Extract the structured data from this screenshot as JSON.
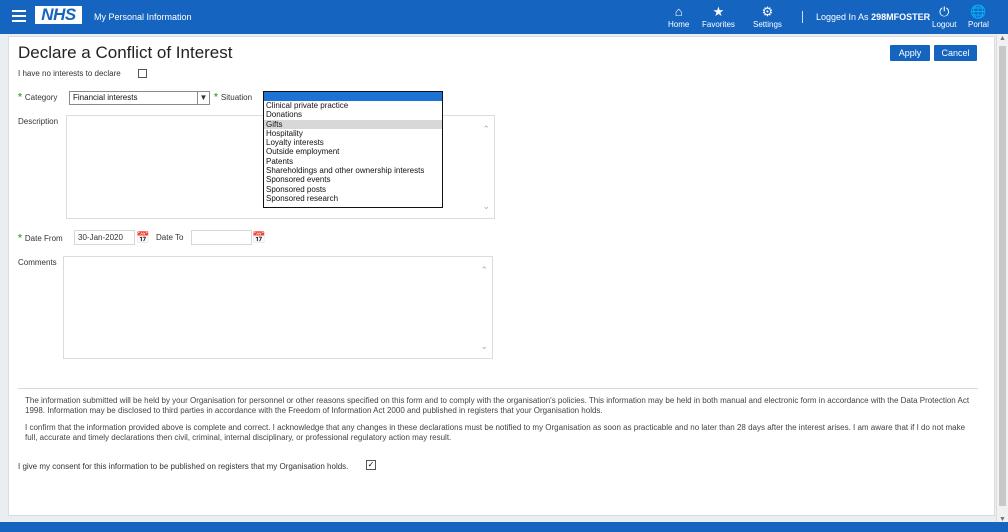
{
  "header": {
    "app_title": "My Personal Information",
    "logo_text": "NHS",
    "nav": [
      {
        "label": "Home",
        "icon": "home-icon"
      },
      {
        "label": "Favorites",
        "icon": "star-icon"
      },
      {
        "label": "Settings",
        "icon": "gear-icon"
      }
    ],
    "login_prefix": "Logged In As",
    "username": "298MFOSTER",
    "logout_label": "Logout",
    "portal_label": "Portal"
  },
  "form": {
    "title": "Declare a Conflict of Interest",
    "apply_label": "Apply",
    "cancel_label": "Cancel",
    "no_interests_label": "I have no interests to declare",
    "category_label": "Category",
    "category_value": "Financial interests",
    "situation_label": "Situation",
    "situation_options": [
      "Clinical private practice",
      "Donations",
      "Gifts",
      "Hospitality",
      "Loyalty interests",
      "Outside employment",
      "Patents",
      "Shareholdings and other ownership interests",
      "Sponsored events",
      "Sponsored posts",
      "Sponsored research"
    ],
    "situation_highlighted": "Gifts",
    "description_label": "Description",
    "date_from_label": "Date From",
    "date_from_value": "30-Jan-2020",
    "date_to_label": "Date To",
    "date_to_value": "",
    "comments_label": "Comments",
    "info_para": "The information submitted will be held by your Organisation for personnel or other reasons specified on this form and to comply with the organisation's policies. This information may be held in both manual and electronic form in accordance with the Data Protection Act 1998. Information may be disclosed to third parties in accordance with the Freedom of Information Act 2000 and published in registers that your Organisation holds.",
    "confirm_para": "I confirm that the information provided above is complete and correct. I acknowledge that any changes in these declarations must be notified to my Organisation as soon as practicable and no later than 28 days after the interest arises. I am aware that if I do not make full, accurate and timely declarations then civil, criminal, internal disciplinary, or professional regulatory action may result.",
    "consent_label": "I give my consent for this information to be published on registers that my Organisation holds."
  },
  "colors": {
    "header_bg": "#1565c0",
    "button_bg": "#1565c0",
    "required_marker": "#49a84a",
    "dropdown_selected": "#1d73d4"
  }
}
